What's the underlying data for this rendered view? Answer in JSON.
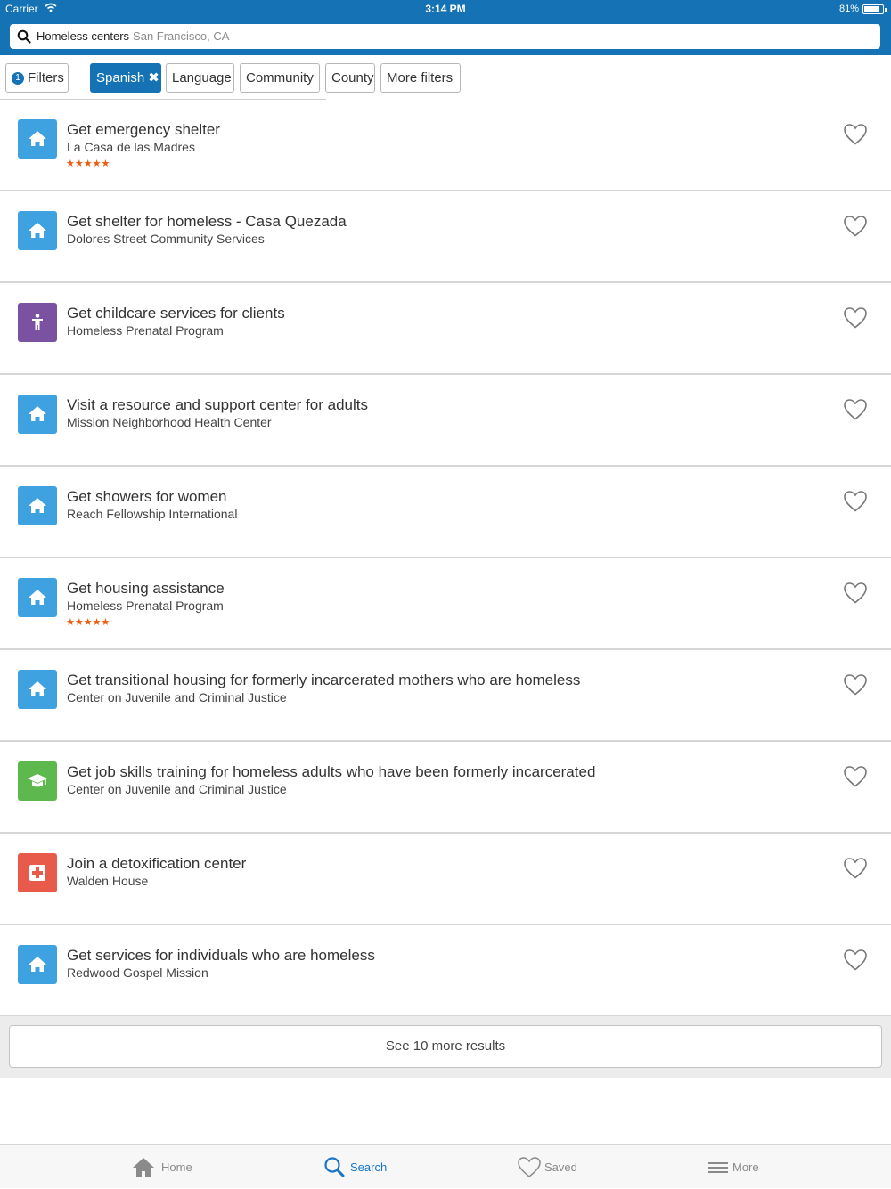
{
  "status_bar": {
    "carrier": "Carrier",
    "time": "3:14 PM",
    "battery": "81%"
  },
  "search": {
    "query": "Homeless centers",
    "location": "San Francisco, CA"
  },
  "filters": {
    "count": "1",
    "filters_label": "Filters",
    "active_filter": "Spanish",
    "chips": [
      "Language",
      "Community",
      "County",
      "More filters"
    ]
  },
  "results": [
    {
      "title": "Get emergency shelter",
      "org": "La Casa de las Madres",
      "icon": "home-icon",
      "color": "#3ea2e0",
      "stars": "★★★★★"
    },
    {
      "title": "Get shelter for homeless - Casa Quezada",
      "org": "Dolores Street Community Services",
      "icon": "home-icon",
      "color": "#3ea2e0",
      "stars": ""
    },
    {
      "title": "Get childcare services for clients",
      "org": "Homeless Prenatal Program",
      "icon": "child-icon",
      "color": "#7b52a1",
      "stars": ""
    },
    {
      "title": "Visit a resource and support center for adults",
      "org": "Mission Neighborhood Health Center",
      "icon": "home-icon",
      "color": "#3ea2e0",
      "stars": ""
    },
    {
      "title": "Get showers for women",
      "org": "Reach Fellowship International",
      "icon": "home-icon",
      "color": "#3ea2e0",
      "stars": ""
    },
    {
      "title": "Get housing assistance",
      "org": "Homeless Prenatal Program",
      "icon": "home-icon",
      "color": "#3ea2e0",
      "stars": "★★★★★"
    },
    {
      "title": "Get transitional housing for formerly incarcerated mothers who are homeless",
      "org": "Center on Juvenile and Criminal Justice",
      "icon": "home-icon",
      "color": "#3ea2e0",
      "stars": ""
    },
    {
      "title": "Get job skills training for homeless adults who have been formerly incarcerated",
      "org": "Center on Juvenile and Criminal Justice",
      "icon": "graduation-cap-icon",
      "color": "#5db84d",
      "stars": ""
    },
    {
      "title": "Join a detoxification center",
      "org": "Walden House",
      "icon": "medical-cross-icon",
      "color": "#e85b4b",
      "stars": ""
    },
    {
      "title": "Get services for individuals who are homeless",
      "org": "Redwood Gospel Mission",
      "icon": "home-icon",
      "color": "#3ea2e0",
      "stars": ""
    }
  ],
  "see_more": "See 10 more results",
  "tabs": [
    {
      "label": "Home",
      "icon": "home-icon"
    },
    {
      "label": "Search",
      "icon": "search-icon"
    },
    {
      "label": "Saved",
      "icon": "heart-icon"
    },
    {
      "label": "More",
      "icon": "menu-icon"
    }
  ]
}
